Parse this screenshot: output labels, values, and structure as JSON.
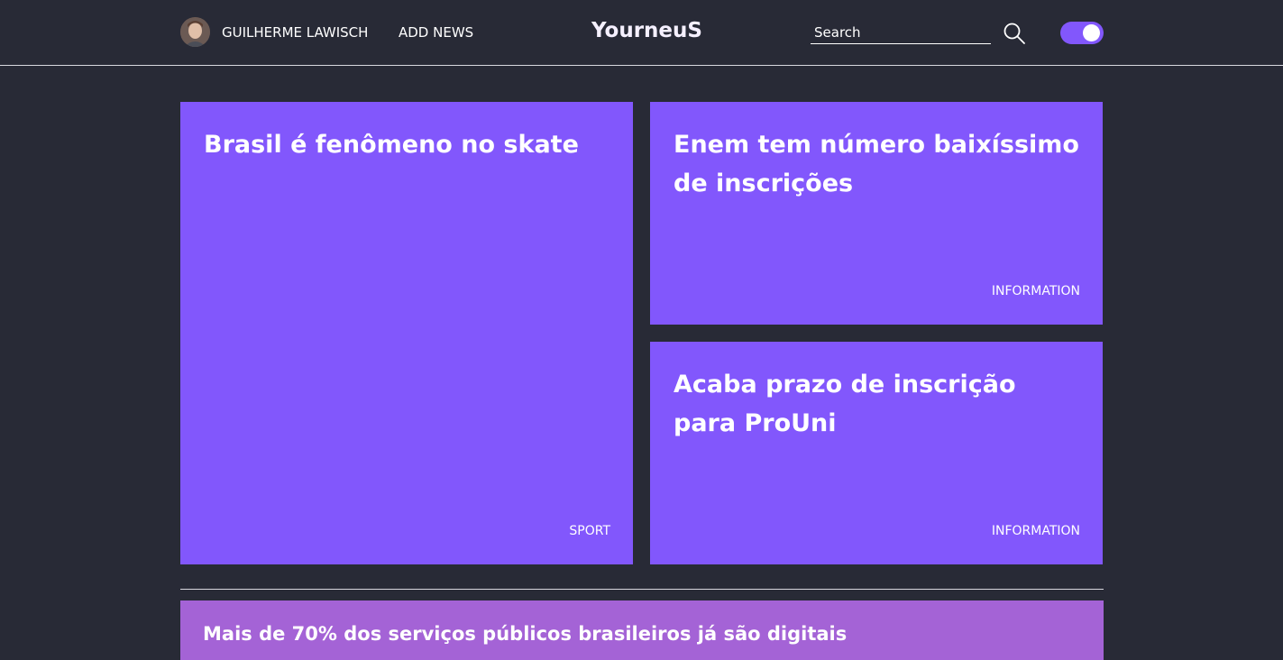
{
  "header": {
    "user_name": "GUILHERME LAWISCH",
    "add_news_label": "ADD NEWS",
    "logo": "YourneuS",
    "search": {
      "placeholder": "Search",
      "value": ""
    },
    "dark_mode_toggle": {
      "on": true
    }
  },
  "news": [
    {
      "title": "Brasil é fenômeno no skate",
      "tag": "SPORT"
    },
    {
      "title": "Enem tem número baixíssimo de inscrições",
      "tag": "INFORMATION"
    },
    {
      "title": "Acaba prazo de inscrição para ProUni",
      "tag": "INFORMATION"
    }
  ],
  "latest": [
    {
      "title": "Mais de 70% dos serviços públicos brasileiros já são digitais"
    }
  ],
  "colors": {
    "background": "#282a36",
    "card": "#8257fc",
    "strip": "#a463d6",
    "text": "#ffffff"
  },
  "icons": {
    "search": "search-icon",
    "avatar": "user-avatar"
  }
}
